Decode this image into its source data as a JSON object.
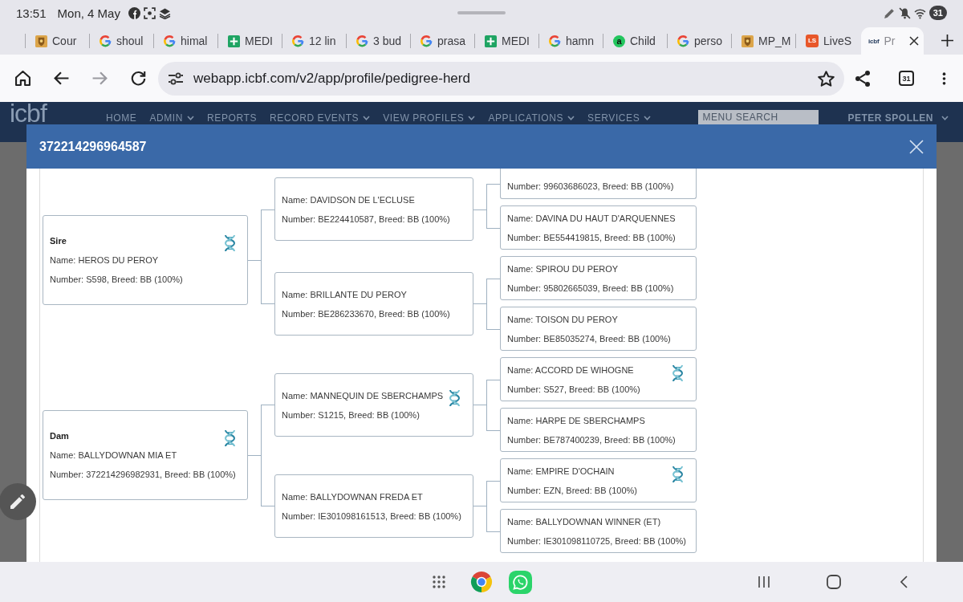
{
  "status_bar": {
    "time": "13:51",
    "date": "Mon, 4 May",
    "battery": "31"
  },
  "browser_tabs": [
    {
      "title": "Cour",
      "kind": "crest",
      "selected": false
    },
    {
      "title": "shoul",
      "kind": "google",
      "selected": false
    },
    {
      "title": "himal",
      "kind": "google",
      "selected": false
    },
    {
      "title": "MEDI",
      "kind": "sheet",
      "selected": false
    },
    {
      "title": "12 lin",
      "kind": "google",
      "selected": false
    },
    {
      "title": "3 bud",
      "kind": "google",
      "selected": false
    },
    {
      "title": "prasa",
      "kind": "google",
      "selected": false
    },
    {
      "title": "MEDI",
      "kind": "sheet",
      "selected": false
    },
    {
      "title": "hamn",
      "kind": "google",
      "selected": false
    },
    {
      "title": "Child",
      "kind": "circle",
      "icon_text": "a",
      "color": "#22c55e",
      "selected": false
    },
    {
      "title": "perso",
      "kind": "google",
      "selected": false
    },
    {
      "title": "MP_M",
      "kind": "crest",
      "selected": false
    },
    {
      "title": "LiveS",
      "kind": "square",
      "icon_text": "LS",
      "color": "#e8572a",
      "selected": false
    },
    {
      "title": "Pr",
      "kind": "wordmark",
      "icon_text": "icbf",
      "selected": true
    }
  ],
  "address_bar": {
    "buttons": [
      {
        "kind": "home",
        "disabled": false
      },
      {
        "kind": "back",
        "disabled": false
      },
      {
        "kind": "forward",
        "disabled": true
      },
      {
        "kind": "reload",
        "disabled": false
      }
    ],
    "url": "webapp.icbf.com/v2/app/profile/pedigree-herd",
    "tab_count": "31"
  },
  "site_header": {
    "logo": "icbf",
    "menu": [
      {
        "label": "HOME",
        "dropdown": false
      },
      {
        "label": "ADMIN",
        "dropdown": true
      },
      {
        "label": "REPORTS",
        "dropdown": false
      },
      {
        "label": "RECORD EVENTS",
        "dropdown": true
      },
      {
        "label": "VIEW PROFILES",
        "dropdown": true
      },
      {
        "label": "APPLICATIONS",
        "dropdown": true
      },
      {
        "label": "SERVICES",
        "dropdown": true
      }
    ],
    "search": {
      "placeholder": "MENU SEARCH"
    },
    "user": {
      "label": "PETER SPOLLEN",
      "dropdown": true
    }
  },
  "modal": {
    "title": "372214296964587",
    "pedigree": [
      {
        "role": "Sire",
        "name": "Name: HEROS DU PEROY",
        "number": "Number: S598, Breed: BB (100%)",
        "dna": true,
        "children": [
          {
            "name": "Name: DAVIDSON DE L'ECLUSE",
            "number": "Number: BE224410587, Breed: BB (100%)",
            "dna": false,
            "children": [
              {
                "number": "Number: 99603686023, Breed: BB (100%)",
                "dna": false
              },
              {
                "name": "Name: DAVINA DU HAUT D'ARQUENNES",
                "number": "Number: BE554419815, Breed: BB (100%)",
                "dna": false
              }
            ]
          },
          {
            "name": "Name: BRILLANTE DU PEROY",
            "number": "Number: BE286233670, Breed: BB (100%)",
            "dna": false,
            "children": [
              {
                "name": "Name: SPIROU DU PEROY",
                "number": "Number: 95802665039, Breed: BB (100%)",
                "dna": false
              },
              {
                "name": "Name: TOISON DU PEROY",
                "number": "Number: BE85035274, Breed: BB (100%)",
                "dna": false
              }
            ]
          }
        ]
      },
      {
        "role": "Dam",
        "name": "Name: BALLYDOWNAN MIA ET",
        "number": "Number: 372214296982931, Breed: BB (100%)",
        "dna": true,
        "children": [
          {
            "name": "Name: MANNEQUIN DE SBERCHAMPS",
            "number": "Number: S1215, Breed: BB (100%)",
            "dna": true,
            "children": [
              {
                "name": "Name: ACCORD DE WIHOGNE",
                "number": "Number: S527, Breed: BB (100%)",
                "dna": true
              },
              {
                "name": "Name: HARPE DE SBERCHAMPS",
                "number": "Number: BE787400239, Breed: BB (100%)",
                "dna": false
              }
            ]
          },
          {
            "name": "Name: BALLYDOWNAN FREDA ET",
            "number": "Number: IE301098161513, Breed: BB (100%)",
            "dna": false,
            "children": [
              {
                "name": "Name: EMPIRE D'OCHAIN",
                "number": "Number: EZN, Breed: BB (100%)",
                "dna": true
              },
              {
                "name": "Name: BALLYDOWNAN WINNER (ET)",
                "number": "Number: IE301098110725, Breed: BB (100%)",
                "dna": false
              }
            ]
          }
        ]
      }
    ]
  }
}
